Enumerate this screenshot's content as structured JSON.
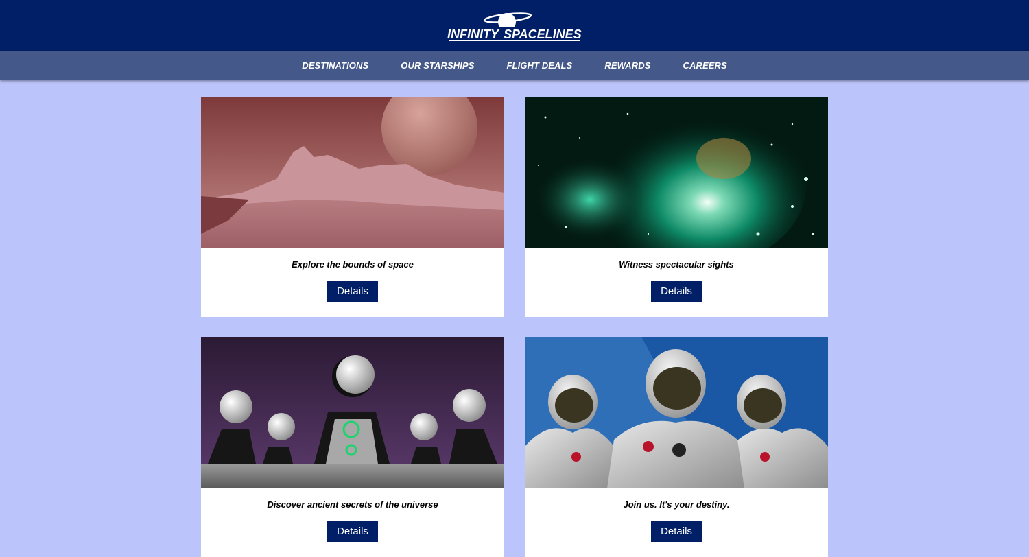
{
  "header": {
    "logo_text_1": "INFINITY",
    "logo_text_2": "SPACELINES",
    "color": "#001f66"
  },
  "nav": {
    "items": [
      {
        "label": "DESTINATIONS"
      },
      {
        "label": "OUR STARSHIPS"
      },
      {
        "label": "FLIGHT DEALS"
      },
      {
        "label": "REWARDS"
      },
      {
        "label": "CAREERS"
      }
    ]
  },
  "cards": [
    {
      "caption": "Explore the bounds of space",
      "button": "Details",
      "image": "alien-planet-landscape"
    },
    {
      "caption": "Witness spectacular sights",
      "button": "Details",
      "image": "green-nebula"
    },
    {
      "caption": "Discover ancient secrets of the universe",
      "button": "Details",
      "image": "orb-council"
    },
    {
      "caption": "Join us. It's your destiny.",
      "button": "Details",
      "image": "astronauts"
    }
  ],
  "colors": {
    "page_bg": "#bcc5fb",
    "nav_bg": "#44588a",
    "button_bg": "#001f66"
  }
}
